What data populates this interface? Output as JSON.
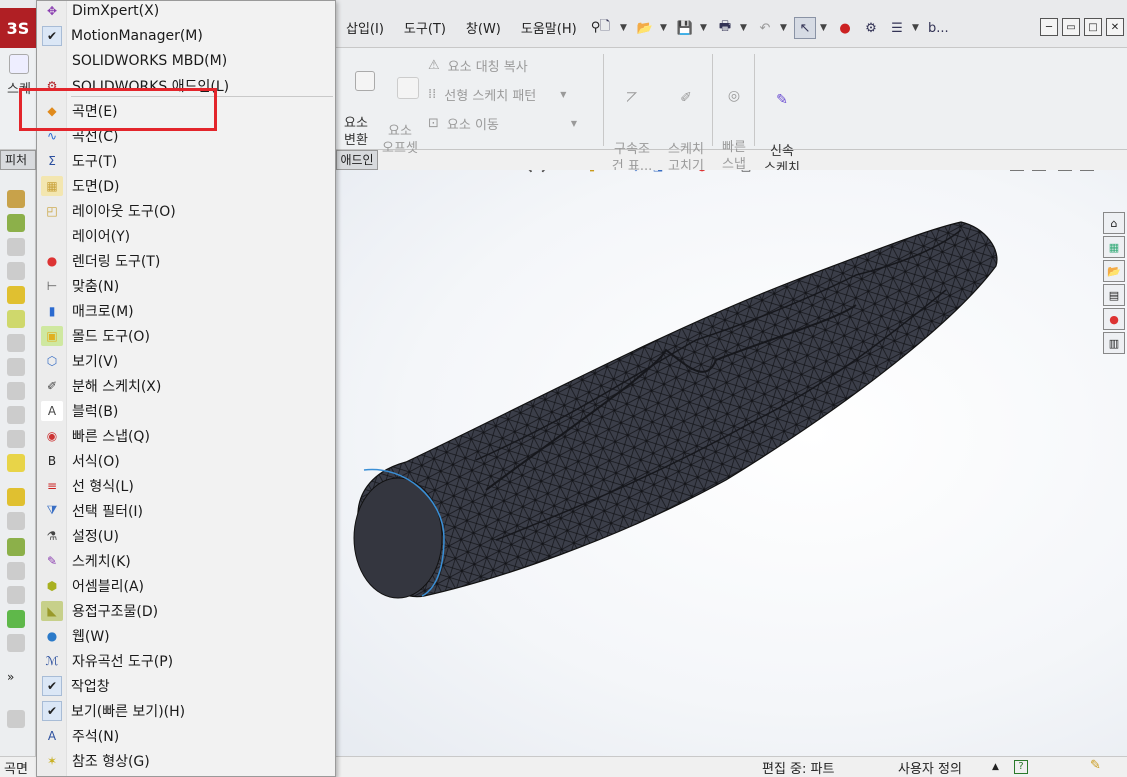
{
  "app": {
    "logo_text": "3S"
  },
  "menubar": {
    "items": [
      "삽입(I)",
      "도구(T)",
      "창(W)",
      "도움말(H)"
    ]
  },
  "toolbar_right": {
    "account_text": "b..."
  },
  "command_manager": {
    "sketch_partial": "스케",
    "entity_convert": "요소\n변환",
    "offset_entities": "요소\n오프셋",
    "mirror_entities": "요소 대칭 복사",
    "linear_pattern": "선형 스케치 패턴",
    "move_entities": "요소 이동",
    "display_relations": "구속조\n건 표...",
    "repair_sketch": "스케치\n고치기",
    "quick_snaps": "빠른\n스냅",
    "rapid_sketch": "신속\n스케치"
  },
  "tabs": {
    "feature_partial": "피처",
    "addin_partial": "애드인"
  },
  "dropdown": {
    "items": [
      {
        "label": "DimXpert(X)",
        "icon": "dimxpert-icon",
        "checked": false
      },
      {
        "label": "MotionManager(M)",
        "icon": "check-icon",
        "checked": true
      },
      {
        "label": "SOLIDWORKS MBD(M)",
        "icon": "none",
        "checked": false
      },
      {
        "label": "SOLIDWORKS 애드인(L)",
        "icon": "addin-icon",
        "checked": false
      },
      {
        "label": "곡면(E)",
        "icon": "surface-icon",
        "checked": false
      },
      {
        "label": "곡선(C)",
        "icon": "curve-icon",
        "checked": false
      },
      {
        "label": "도구(T)",
        "icon": "tools-icon",
        "checked": false
      },
      {
        "label": "도면(D)",
        "icon": "drawing-icon",
        "checked": false
      },
      {
        "label": "레이아웃 도구(O)",
        "icon": "layout-icon",
        "checked": false
      },
      {
        "label": "레이어(Y)",
        "icon": "none",
        "checked": false
      },
      {
        "label": "렌더링 도구(T)",
        "icon": "render-icon",
        "checked": false
      },
      {
        "label": "맞춤(N)",
        "icon": "fit-icon",
        "checked": false
      },
      {
        "label": "매크로(M)",
        "icon": "macro-icon",
        "checked": false
      },
      {
        "label": "몰드 도구(O)",
        "icon": "mold-icon",
        "checked": false
      },
      {
        "label": "보기(V)",
        "icon": "view-icon",
        "checked": false
      },
      {
        "label": "분해 스케치(X)",
        "icon": "explode-sketch-icon",
        "checked": false
      },
      {
        "label": "블럭(B)",
        "icon": "block-icon",
        "checked": false
      },
      {
        "label": "빠른 스냅(Q)",
        "icon": "quick-snap-icon",
        "checked": false
      },
      {
        "label": "서식(O)",
        "icon": "format-icon",
        "checked": false
      },
      {
        "label": "선 형식(L)",
        "icon": "line-format-icon",
        "checked": false
      },
      {
        "label": "선택 필터(I)",
        "icon": "selection-filter-icon",
        "checked": false
      },
      {
        "label": "설정(U)",
        "icon": "settings-icon",
        "checked": false
      },
      {
        "label": "스케치(K)",
        "icon": "sketch-icon",
        "checked": false
      },
      {
        "label": "어셈블리(A)",
        "icon": "assembly-icon",
        "checked": false
      },
      {
        "label": "용접구조물(D)",
        "icon": "weldment-icon",
        "checked": false
      },
      {
        "label": "웹(W)",
        "icon": "web-icon",
        "checked": false
      },
      {
        "label": "자유곡선 도구(P)",
        "icon": "spline-tools-icon",
        "checked": false
      },
      {
        "label": "작업창",
        "icon": "check-icon",
        "checked": true
      },
      {
        "label": "보기(빠른 보기)(H)",
        "icon": "check-icon",
        "checked": true
      },
      {
        "label": "주석(N)",
        "icon": "annotation-icon",
        "checked": false
      },
      {
        "label": "참조 형상(G)",
        "icon": "reference-geometry-icon",
        "checked": false
      }
    ]
  },
  "statusbar": {
    "left_partial": "곡면",
    "editing": "편집 중: 파트",
    "custom": "사용자 정의",
    "help_symbol": "?"
  },
  "colors": {
    "highlight_border": "#e3252b",
    "model_fill": "#3a3d47",
    "model_edge": "#111111",
    "accent_blue": "#3a8fd6"
  }
}
